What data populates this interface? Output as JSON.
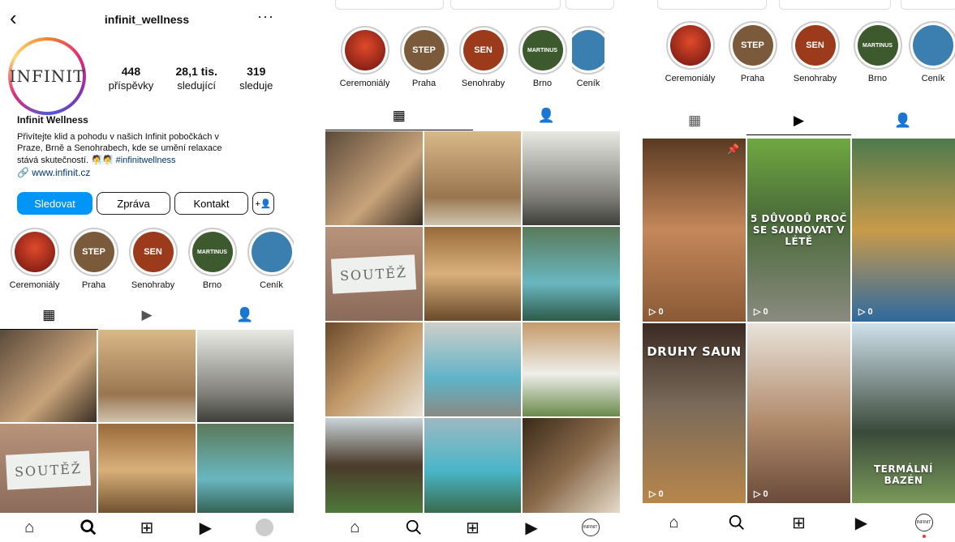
{
  "profile": {
    "username": "infinit_wellness",
    "display_name": "Infinit Wellness",
    "logo_text": "INFINIT",
    "stats": [
      {
        "num": "448",
        "label": "příspěvky"
      },
      {
        "num": "28,1 tis.",
        "label": "sledující"
      },
      {
        "num": "319",
        "label": "sleduje"
      }
    ],
    "bio_line1": "Přivítejte klid a pohodu v našich Infinit pobočkách v",
    "bio_line2": "Praze, Brně a Senohrabech, kde se umění relaxace",
    "bio_line3": "stává skutečností.",
    "hashtag": "#infinitwellness",
    "website": "www.infinit.cz"
  },
  "buttons": {
    "follow": "Sledovat",
    "message": "Zpráva",
    "contact": "Kontakt"
  },
  "highlights": [
    {
      "label": "Ceremoniály",
      "badge": "",
      "color": "#b3261e"
    },
    {
      "label": "Praha",
      "badge": "STEP",
      "color": "#7a5a3a"
    },
    {
      "label": "Senohraby",
      "badge": "SEN",
      "color": "#9b3b1b"
    },
    {
      "label": "Brno",
      "badge": "MARTINUS",
      "color": "#3d5a2e"
    },
    {
      "label": "Ceník",
      "badge": "",
      "color": "#3b7fb0"
    }
  ],
  "screen3_captions": {
    "reel2": "5 DŮVODŮ PROČ SE SAUNOVAT V LÉTĚ",
    "reel4": "DRUHY SAUN",
    "reel6": "TERMÁLNÍ BAZÉN",
    "views": "0"
  },
  "post_caption": "SOUTĚŽ",
  "colors": {
    "accent": "#0095f6",
    "link": "#00376b",
    "notification": "#ff3040"
  }
}
